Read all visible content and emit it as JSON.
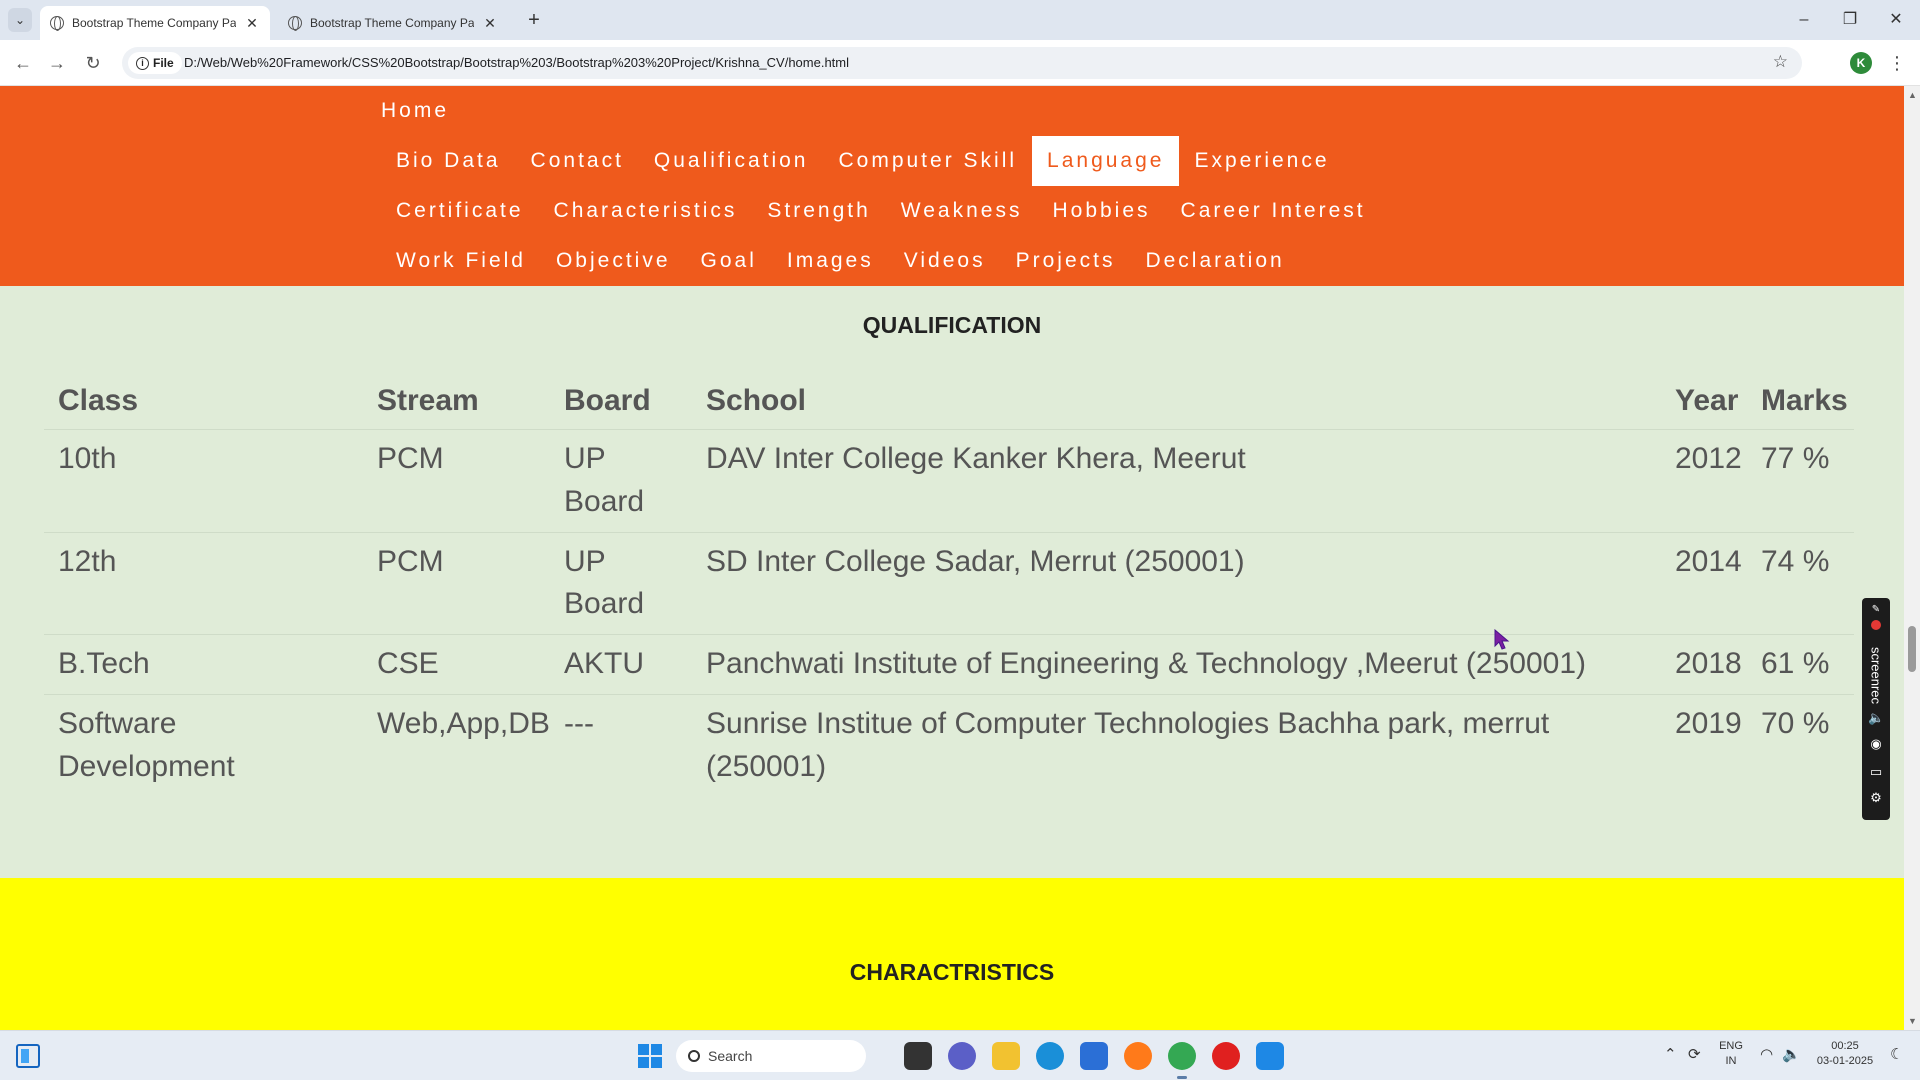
{
  "browser": {
    "tabs": [
      {
        "title": "Bootstrap Theme Company Pa",
        "active": true
      },
      {
        "title": "Bootstrap Theme Company Pa",
        "active": false
      }
    ],
    "new_tab": "+",
    "url_chip": "File",
    "url": "D:/Web/Web%20Framework/CSS%20Bootstrap/Bootstrap%203/Bootstrap%203%20Project/Krishna_CV/home.html",
    "profile_initial": "K",
    "window_controls": {
      "minimize": "–",
      "restore": "❐",
      "close": "✕"
    }
  },
  "nav": {
    "home": "Home",
    "rows": [
      [
        "Bio Data",
        "Contact",
        "Qualification",
        "Computer Skill",
        "Language",
        "Experience"
      ],
      [
        "Certificate",
        "Characteristics",
        "Strength",
        "Weakness",
        "Hobbies",
        "Career Interest"
      ],
      [
        "Work Field",
        "Objective",
        "Goal",
        "Images",
        "Videos",
        "Projects",
        "Declaration"
      ]
    ],
    "active": "Language",
    "colors": {
      "bar": "#ef5a1c",
      "text": "#ffffff"
    }
  },
  "qualification": {
    "title": "QUALIFICATION",
    "headers": [
      "Class",
      "Stream",
      "Board",
      "School",
      "Year",
      "Marks"
    ],
    "rows": [
      {
        "class": [
          "10th"
        ],
        "stream": "PCM",
        "board": [
          "UP",
          "Board"
        ],
        "school": [
          "DAV Inter College Kanker Khera, Meerut"
        ],
        "year": "2012",
        "marks": "77 %"
      },
      {
        "class": [
          "12th"
        ],
        "stream": "PCM",
        "board": [
          "UP",
          "Board"
        ],
        "school": [
          "SD Inter College Sadar, Merrut (250001)"
        ],
        "year": "2014",
        "marks": "74 %"
      },
      {
        "class": [
          "B.Tech"
        ],
        "stream": "CSE",
        "board": [
          "AKTU"
        ],
        "school": [
          "Panchwati Institute of Engineering & Technology ,Meerut (250001)"
        ],
        "year": "2018",
        "marks": "61 %"
      },
      {
        "class": [
          "Software",
          "Development"
        ],
        "stream": "Web,App,DB",
        "board": [
          "---"
        ],
        "school": [
          "Sunrise Institue of Computer Technologies Bachha park, merrut",
          "(250001)"
        ],
        "year": "2019",
        "marks": "70 %"
      }
    ],
    "background": "#e0ecd8"
  },
  "characteristics": {
    "title": "CHARACTRISTICS",
    "background": "#ffff00"
  },
  "screenrec": {
    "label": "screenrec"
  },
  "taskbar": {
    "search_placeholder": "Search",
    "tray": {
      "lang_top": "ENG",
      "lang_bottom": "IN",
      "time": "00:25",
      "date": "03-01-2025"
    }
  }
}
